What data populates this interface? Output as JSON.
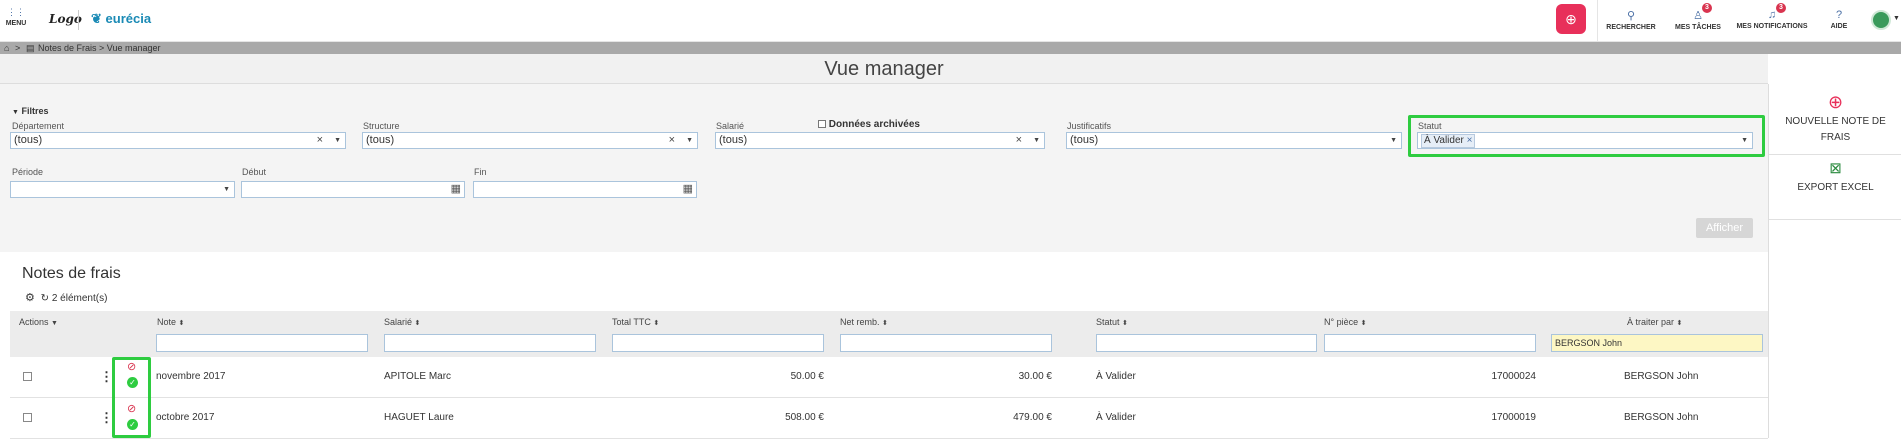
{
  "topbar": {
    "menu_label": "MENU",
    "logo_text": "Logo",
    "brand_text": "eurécia",
    "search_label": "RECHERCHER",
    "tasks_label": "MES TÂCHES",
    "tasks_count": "3",
    "notifications_label": "MES NOTIFICATIONS",
    "notifications_count": "3",
    "help_label": "AIDE",
    "accent_color": "#e8305a"
  },
  "breadcrumb": {
    "home_sep": ">",
    "path": "Notes de Frais > Vue manager"
  },
  "page_title": "Vue manager",
  "filters": {
    "toggle_label": "Filtres",
    "departement": {
      "label": "Département",
      "value": "(tous)"
    },
    "structure": {
      "label": "Structure",
      "value": "(tous)"
    },
    "salarie": {
      "label": "Salarié",
      "value": "(tous)"
    },
    "archived_label": "Données archivées",
    "justificatifs": {
      "label": "Justificatifs",
      "value": "(tous)"
    },
    "statut": {
      "label": "Statut",
      "tag": "À Valider"
    },
    "periode": {
      "label": "Période",
      "value": ""
    },
    "debut": {
      "label": "Début",
      "value": ""
    },
    "fin": {
      "label": "Fin",
      "value": ""
    },
    "submit_label": "Afficher"
  },
  "right_panel": {
    "new_note_label": "NOUVELLE NOTE DE FRAIS",
    "export_label": "EXPORT EXCEL"
  },
  "table": {
    "title": "Notes de frais",
    "count_label": "2 élément(s)",
    "columns": {
      "actions": "Actions",
      "note": "Note",
      "salarie": "Salarié",
      "total_ttc": "Total TTC",
      "net_remb": "Net remb.",
      "statut": "Statut",
      "piece": "N° pièce",
      "traiter_par": "À traiter par"
    },
    "filter_traiter_par": "BERGSON John",
    "rows": [
      {
        "note": "novembre 2017",
        "salarie": "APITOLE Marc",
        "total_ttc": "50.00 €",
        "net_remb": "30.00 €",
        "statut": "À Valider",
        "piece": "17000024",
        "traiter_par": "BERGSON John"
      },
      {
        "note": "octobre 2017",
        "salarie": "HAGUET Laure",
        "total_ttc": "508.00 €",
        "net_remb": "479.00 €",
        "statut": "À Valider",
        "piece": "17000019",
        "traiter_par": "BERGSON John"
      }
    ]
  }
}
